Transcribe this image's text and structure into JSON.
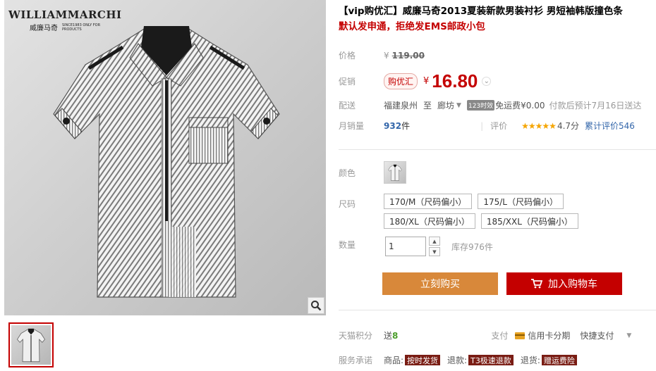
{
  "brand": {
    "name": "WILLIAMMARCHI",
    "cn_name": "威廉马奇",
    "tagline": "SINCE1983 ONLY FOR PRODUCTS"
  },
  "product": {
    "title": "【vip购优汇】威廉马奇2013夏装新款男装衬衫 男短袖韩版撞色条",
    "subtitle": "默认发申通，拒绝发EMS邮政小包"
  },
  "price": {
    "label": "价格",
    "currency": "¥",
    "original": "119.00"
  },
  "promo": {
    "label": "促销",
    "badge": "购优汇",
    "currency": "¥",
    "price": "16.80"
  },
  "shipping": {
    "label": "配送",
    "from": "福建泉州",
    "to_word": "至",
    "destination": "廊坊",
    "efficiency_badge": "123时效",
    "freight": "免运费¥0.00",
    "delivery_note": "付款后预计7月16日送达"
  },
  "sales": {
    "label": "月销量",
    "count": "932",
    "unit": "件",
    "rating_label": "评价",
    "stars": "★★★★★",
    "score": "4.7分",
    "reviews": "累计评价546"
  },
  "color": {
    "label": "颜色"
  },
  "size": {
    "label": "尺码",
    "options": [
      "170/M（尺码偏小）",
      "175/L（尺码偏小）",
      "180/XL（尺码偏小）",
      "185/XXL（尺码偏小）"
    ]
  },
  "quantity": {
    "label": "数量",
    "value": "1",
    "stock": "库存976件"
  },
  "buttons": {
    "buy": "立刻购买",
    "cart": "加入购物车"
  },
  "points": {
    "label": "天猫积分",
    "gift_prefix": "送",
    "gift_value": "8"
  },
  "payment": {
    "label": "支付",
    "card": "信用卡分期",
    "express": "快捷支付"
  },
  "service": {
    "label": "服务承诺",
    "items": [
      {
        "prefix": "商品:",
        "tag": "按时发货"
      },
      {
        "prefix": "退款:",
        "tag": "T3极速退款"
      },
      {
        "prefix": "退货:",
        "tag": "赠运费险"
      }
    ]
  },
  "colors": {
    "accent_red": "#c40000",
    "buy_orange": "#d8883a",
    "link_blue": "#3366aa",
    "star_gold": "#f5a500"
  }
}
